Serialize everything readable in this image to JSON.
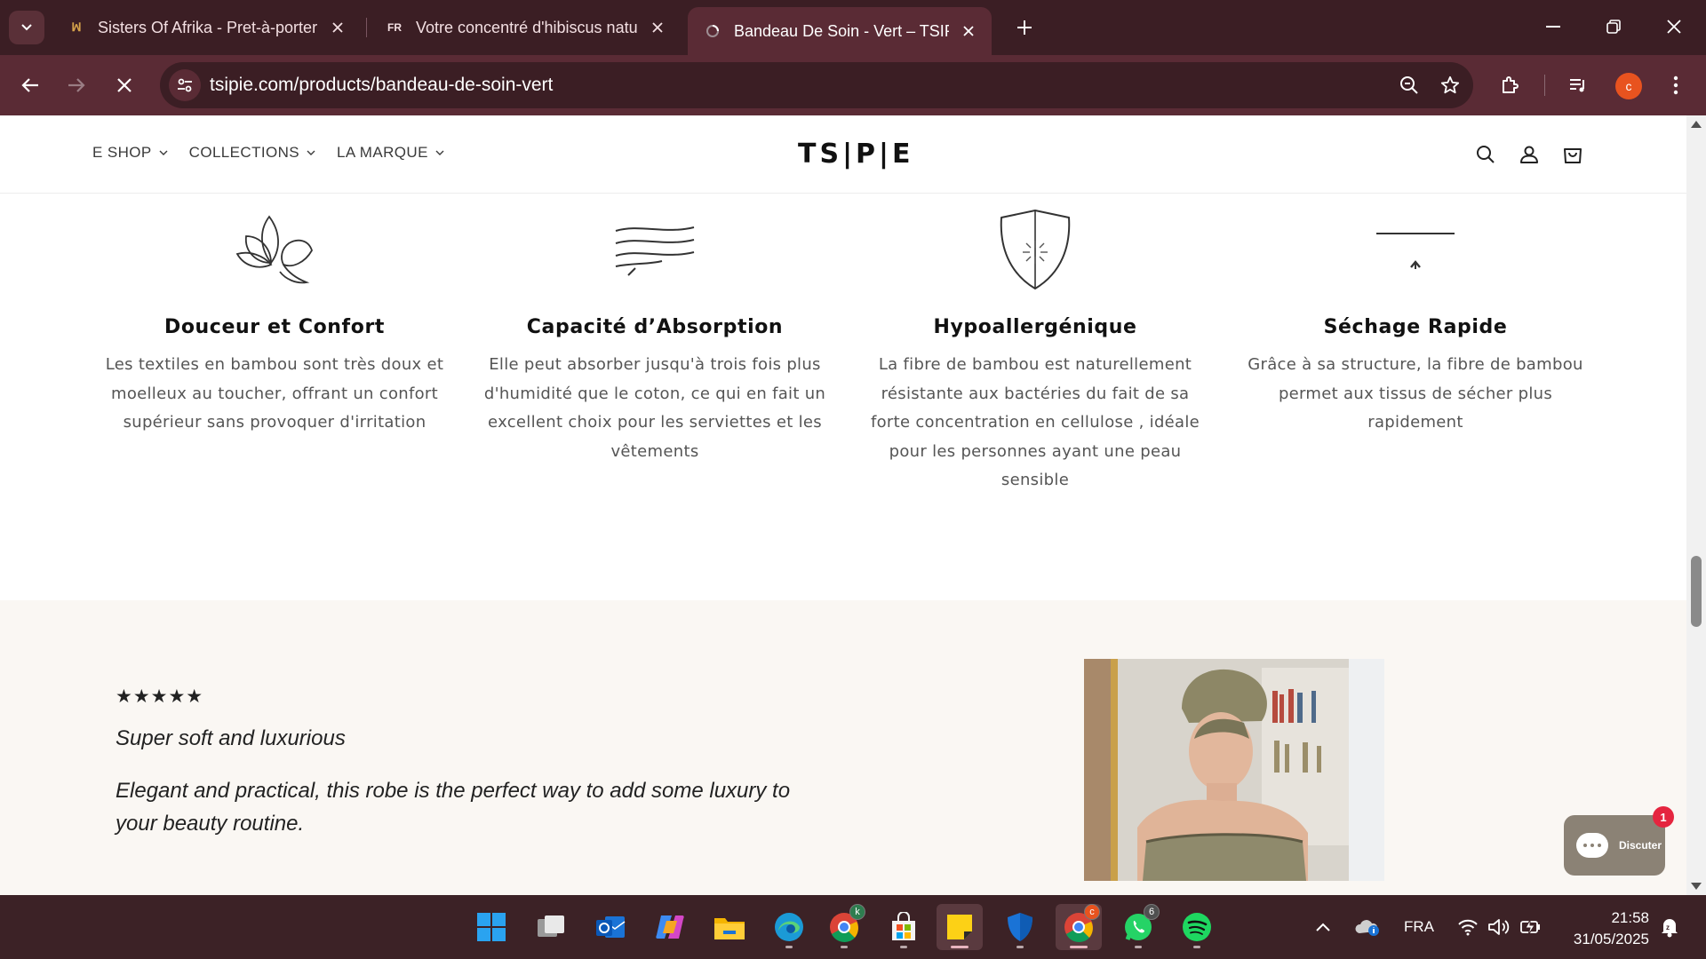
{
  "browser": {
    "tabs": [
      {
        "title": "Sisters Of Afrika - Pret-à-porter",
        "icon": "sisters-logo-icon"
      },
      {
        "title": "Votre concentré d'hibiscus natu",
        "icon_text": "FR"
      },
      {
        "title": "Bandeau De Soin - Vert – TSIPIE",
        "icon": "loading-icon"
      }
    ],
    "url": "tsipie.com/products/bandeau-de-soin-vert",
    "profile_initial": "c"
  },
  "site": {
    "nav": [
      {
        "label": "E SHOP"
      },
      {
        "label": "COLLECTIONS"
      },
      {
        "label": "LA MARQUE"
      }
    ],
    "logo": "TS|P|E"
  },
  "features": [
    {
      "icon": "lotus-icon",
      "title": "Douceur et Confort",
      "desc": "Les textiles en bambou sont très doux et moelleux au toucher, offrant un confort supérieur sans provoquer d'irritation"
    },
    {
      "icon": "waves-icon",
      "title": "Capacité d’Absorption",
      "desc": "Elle peut absorber jusqu'à trois fois plus d'humidité que le coton, ce qui en fait un excellent choix pour les serviettes et les vêtements"
    },
    {
      "icon": "shield-icon",
      "title": "Hypoallergénique",
      "desc": "La fibre de bambou est naturellement résistante aux bactéries du fait de sa forte concentration en cellulose , idéale pour les personnes ayant une peau sensible"
    },
    {
      "icon": "fast-dry-icon",
      "title": "Séchage Rapide",
      "desc": "Grâce à sa structure, la fibre de bambou permet aux tissus de sécher plus rapidement"
    }
  ],
  "testimonial": {
    "stars": "★★★★★",
    "title": "Super soft and luxurious",
    "body": "Elegant and practical, this robe is the perfect way to add some luxury to your beauty routine."
  },
  "chat": {
    "label": "Discuter",
    "badge": "1"
  },
  "taskbar": {
    "chrome_badge": "k",
    "whatsapp_badge": "6",
    "language": "FRA",
    "time": "21:58",
    "date": "31/05/2025",
    "chrome2_badge": "c"
  }
}
